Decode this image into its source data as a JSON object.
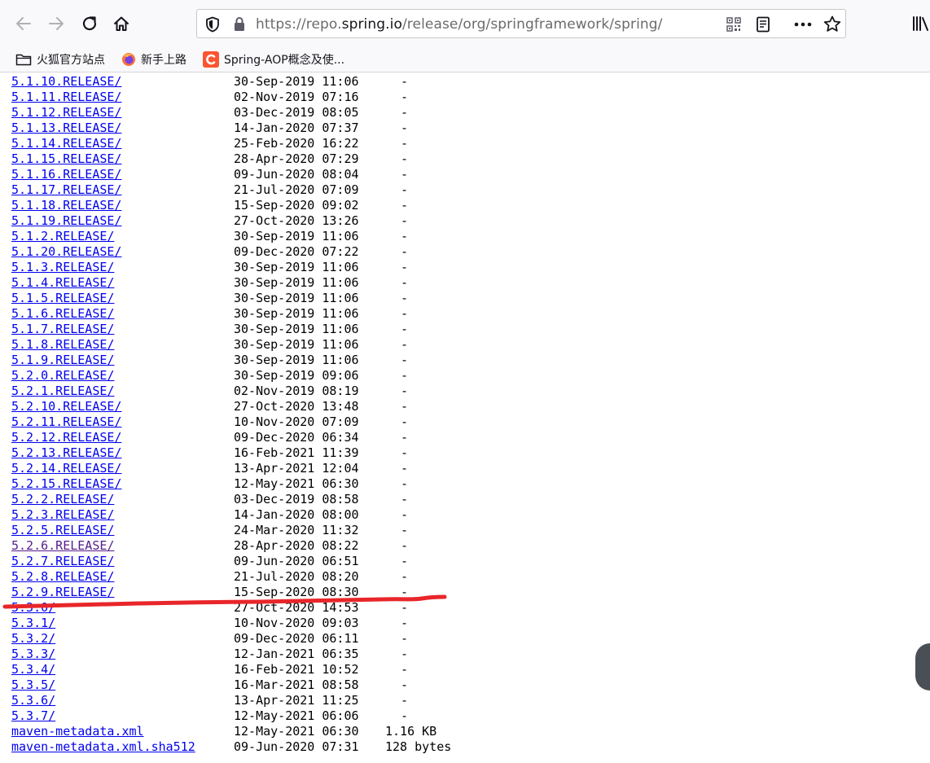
{
  "browser": {
    "url_prefix": "https://repo.",
    "url_domain": "spring.io",
    "url_suffix": "/release/org/springframework/spring/",
    "icons": {
      "back": "back-arrow-icon",
      "forward": "forward-arrow-icon",
      "reload": "reload-icon",
      "home": "home-icon",
      "shield": "tracking-shield-icon",
      "lock": "lock-icon",
      "qr": "qr-code-icon",
      "reader": "reader-view-icon",
      "more": "more-actions-icon",
      "star": "bookmark-star-icon",
      "library": "library-icon"
    }
  },
  "bookmarks": [
    {
      "label": "火狐官方站点",
      "icon": "folder-icon"
    },
    {
      "label": "新手上路",
      "icon": "firefox-logo-icon"
    },
    {
      "label": "Spring-AOP概念及使...",
      "icon": "csdn-logo-icon"
    }
  ],
  "colors": {
    "link": "#0000ee",
    "visited_link": "#551a8b",
    "annotation": "#e8262a",
    "chrome_bg": "#f9f9fb"
  },
  "listing": [
    {
      "name": "5.1.10.RELEASE/",
      "date": "30-Sep-2019 11:06",
      "size": "-"
    },
    {
      "name": "5.1.11.RELEASE/",
      "date": "02-Nov-2019 07:16",
      "size": "-"
    },
    {
      "name": "5.1.12.RELEASE/",
      "date": "03-Dec-2019 08:05",
      "size": "-"
    },
    {
      "name": "5.1.13.RELEASE/",
      "date": "14-Jan-2020 07:37",
      "size": "-"
    },
    {
      "name": "5.1.14.RELEASE/",
      "date": "25-Feb-2020 16:22",
      "size": "-"
    },
    {
      "name": "5.1.15.RELEASE/",
      "date": "28-Apr-2020 07:29",
      "size": "-"
    },
    {
      "name": "5.1.16.RELEASE/",
      "date": "09-Jun-2020 08:04",
      "size": "-"
    },
    {
      "name": "5.1.17.RELEASE/",
      "date": "21-Jul-2020 07:09",
      "size": "-"
    },
    {
      "name": "5.1.18.RELEASE/",
      "date": "15-Sep-2020 09:02",
      "size": "-"
    },
    {
      "name": "5.1.19.RELEASE/",
      "date": "27-Oct-2020 13:26",
      "size": "-"
    },
    {
      "name": "5.1.2.RELEASE/",
      "date": "30-Sep-2019 11:06",
      "size": "-"
    },
    {
      "name": "5.1.20.RELEASE/",
      "date": "09-Dec-2020 07:22",
      "size": "-"
    },
    {
      "name": "5.1.3.RELEASE/",
      "date": "30-Sep-2019 11:06",
      "size": "-"
    },
    {
      "name": "5.1.4.RELEASE/",
      "date": "30-Sep-2019 11:06",
      "size": "-"
    },
    {
      "name": "5.1.5.RELEASE/",
      "date": "30-Sep-2019 11:06",
      "size": "-"
    },
    {
      "name": "5.1.6.RELEASE/",
      "date": "30-Sep-2019 11:06",
      "size": "-"
    },
    {
      "name": "5.1.7.RELEASE/",
      "date": "30-Sep-2019 11:06",
      "size": "-"
    },
    {
      "name": "5.1.8.RELEASE/",
      "date": "30-Sep-2019 11:06",
      "size": "-"
    },
    {
      "name": "5.1.9.RELEASE/",
      "date": "30-Sep-2019 11:06",
      "size": "-"
    },
    {
      "name": "5.2.0.RELEASE/",
      "date": "30-Sep-2019 09:06",
      "size": "-"
    },
    {
      "name": "5.2.1.RELEASE/",
      "date": "02-Nov-2019 08:19",
      "size": "-"
    },
    {
      "name": "5.2.10.RELEASE/",
      "date": "27-Oct-2020 13:48",
      "size": "-"
    },
    {
      "name": "5.2.11.RELEASE/",
      "date": "10-Nov-2020 07:09",
      "size": "-"
    },
    {
      "name": "5.2.12.RELEASE/",
      "date": "09-Dec-2020 06:34",
      "size": "-"
    },
    {
      "name": "5.2.13.RELEASE/",
      "date": "16-Feb-2021 11:39",
      "size": "-"
    },
    {
      "name": "5.2.14.RELEASE/",
      "date": "13-Apr-2021 12:04",
      "size": "-"
    },
    {
      "name": "5.2.15.RELEASE/",
      "date": "12-May-2021 06:30",
      "size": "-"
    },
    {
      "name": "5.2.2.RELEASE/",
      "date": "03-Dec-2019 08:58",
      "size": "-"
    },
    {
      "name": "5.2.3.RELEASE/",
      "date": "14-Jan-2020 08:00",
      "size": "-"
    },
    {
      "name": "5.2.5.RELEASE/",
      "date": "24-Mar-2020 11:32",
      "size": "-"
    },
    {
      "name": "5.2.6.RELEASE/",
      "date": "28-Apr-2020 08:22",
      "size": "-",
      "visited": true
    },
    {
      "name": "5.2.7.RELEASE/",
      "date": "09-Jun-2020 06:51",
      "size": "-"
    },
    {
      "name": "5.2.8.RELEASE/",
      "date": "21-Jul-2020 08:20",
      "size": "-"
    },
    {
      "name": "5.2.9.RELEASE/",
      "date": "15-Sep-2020 08:30",
      "size": "-"
    },
    {
      "name": "5.3.0/",
      "date": "27-Oct-2020 14:53",
      "size": "-"
    },
    {
      "name": "5.3.1/",
      "date": "10-Nov-2020 09:03",
      "size": "-"
    },
    {
      "name": "5.3.2/",
      "date": "09-Dec-2020 06:11",
      "size": "-"
    },
    {
      "name": "5.3.3/",
      "date": "12-Jan-2021 06:35",
      "size": "-"
    },
    {
      "name": "5.3.4/",
      "date": "16-Feb-2021 10:52",
      "size": "-"
    },
    {
      "name": "5.3.5/",
      "date": "16-Mar-2021 08:58",
      "size": "-"
    },
    {
      "name": "5.3.6/",
      "date": "13-Apr-2021 11:25",
      "size": "-"
    },
    {
      "name": "5.3.7/",
      "date": "12-May-2021 06:06",
      "size": "-"
    },
    {
      "name": "maven-metadata.xml",
      "date": "12-May-2021 06:30",
      "size": "1.16 KB"
    },
    {
      "name": "maven-metadata.xml.sha512",
      "date": "09-Jun-2020 07:31",
      "size": "128 bytes"
    }
  ]
}
